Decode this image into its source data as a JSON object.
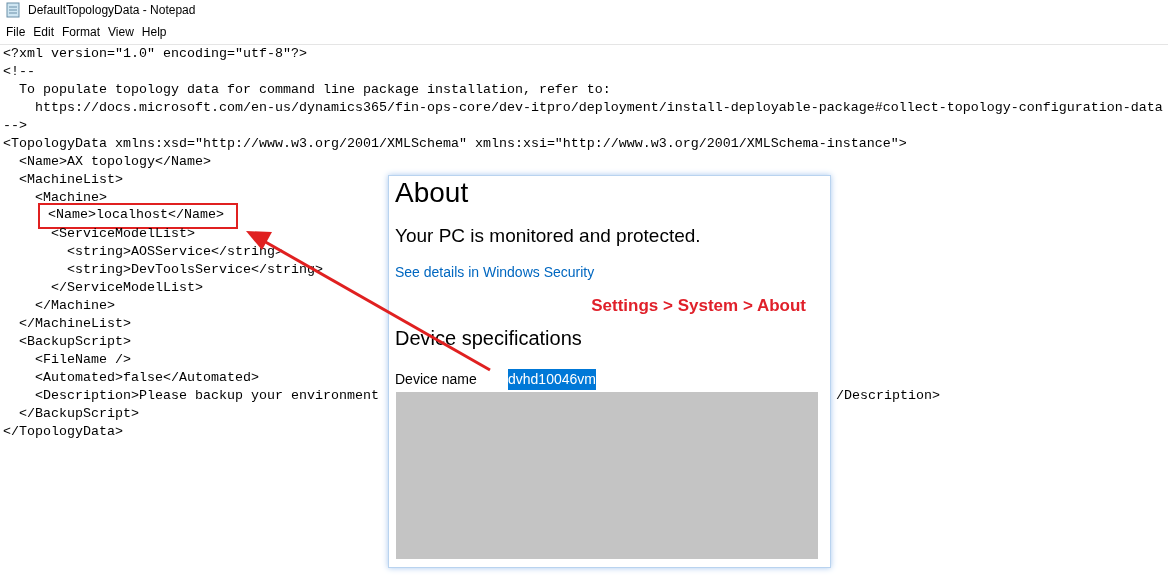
{
  "window": {
    "title": "DefaultTopologyData - Notepad"
  },
  "menu": [
    "File",
    "Edit",
    "Format",
    "View",
    "Help"
  ],
  "lines": [
    {
      "text": "<?xml version=\"1.0\" encoding=\"utf-8\"?>"
    },
    {
      "text": "<!--"
    },
    {
      "text": "  To populate topology data for command line package installation, refer to:"
    },
    {
      "text": "    https://docs.microsoft.com/en-us/dynamics365/fin-ops-core/dev-itpro/deployment/install-deployable-package#collect-topology-configuration-data"
    },
    {
      "text": "-->"
    },
    {
      "text": "<TopologyData xmlns:xsd=\"http://www.w3.org/2001/XMLSchema\" xmlns:xsi=\"http://www.w3.org/2001/XMLSchema-instance\">"
    },
    {
      "text": "  <Name>AX topology</Name>"
    },
    {
      "text": "  <MachineList>"
    },
    {
      "text": "    <Machine>"
    },
    {
      "text": "      <Name>localhost</Name>",
      "highlighted": true
    },
    {
      "text": "      <ServiceModelList>"
    },
    {
      "text": "        <string>AOSService</string>"
    },
    {
      "text": "        <string>DevToolsService</string>"
    },
    {
      "text": "      </ServiceModelList>"
    },
    {
      "text": "    </Machine>"
    },
    {
      "text": "  </MachineList>"
    },
    {
      "text": "  <BackupScript>"
    },
    {
      "text": "    <FileName />"
    },
    {
      "text": "    <Automated>false</Automated>"
    },
    {
      "text": "    <Description>Please backup your environment",
      "tail": "/Description>"
    },
    {
      "text": "  </BackupScript>"
    },
    {
      "text": "</TopologyData>"
    }
  ],
  "about": {
    "title": "About",
    "status": "Your PC is monitored and protected.",
    "link": "See details in Windows Security",
    "annotation": "Settings > System > About",
    "section": "Device specifications",
    "specs": [
      {
        "label": "Device name",
        "value": "dvhd10046vm",
        "selected": true
      }
    ]
  }
}
